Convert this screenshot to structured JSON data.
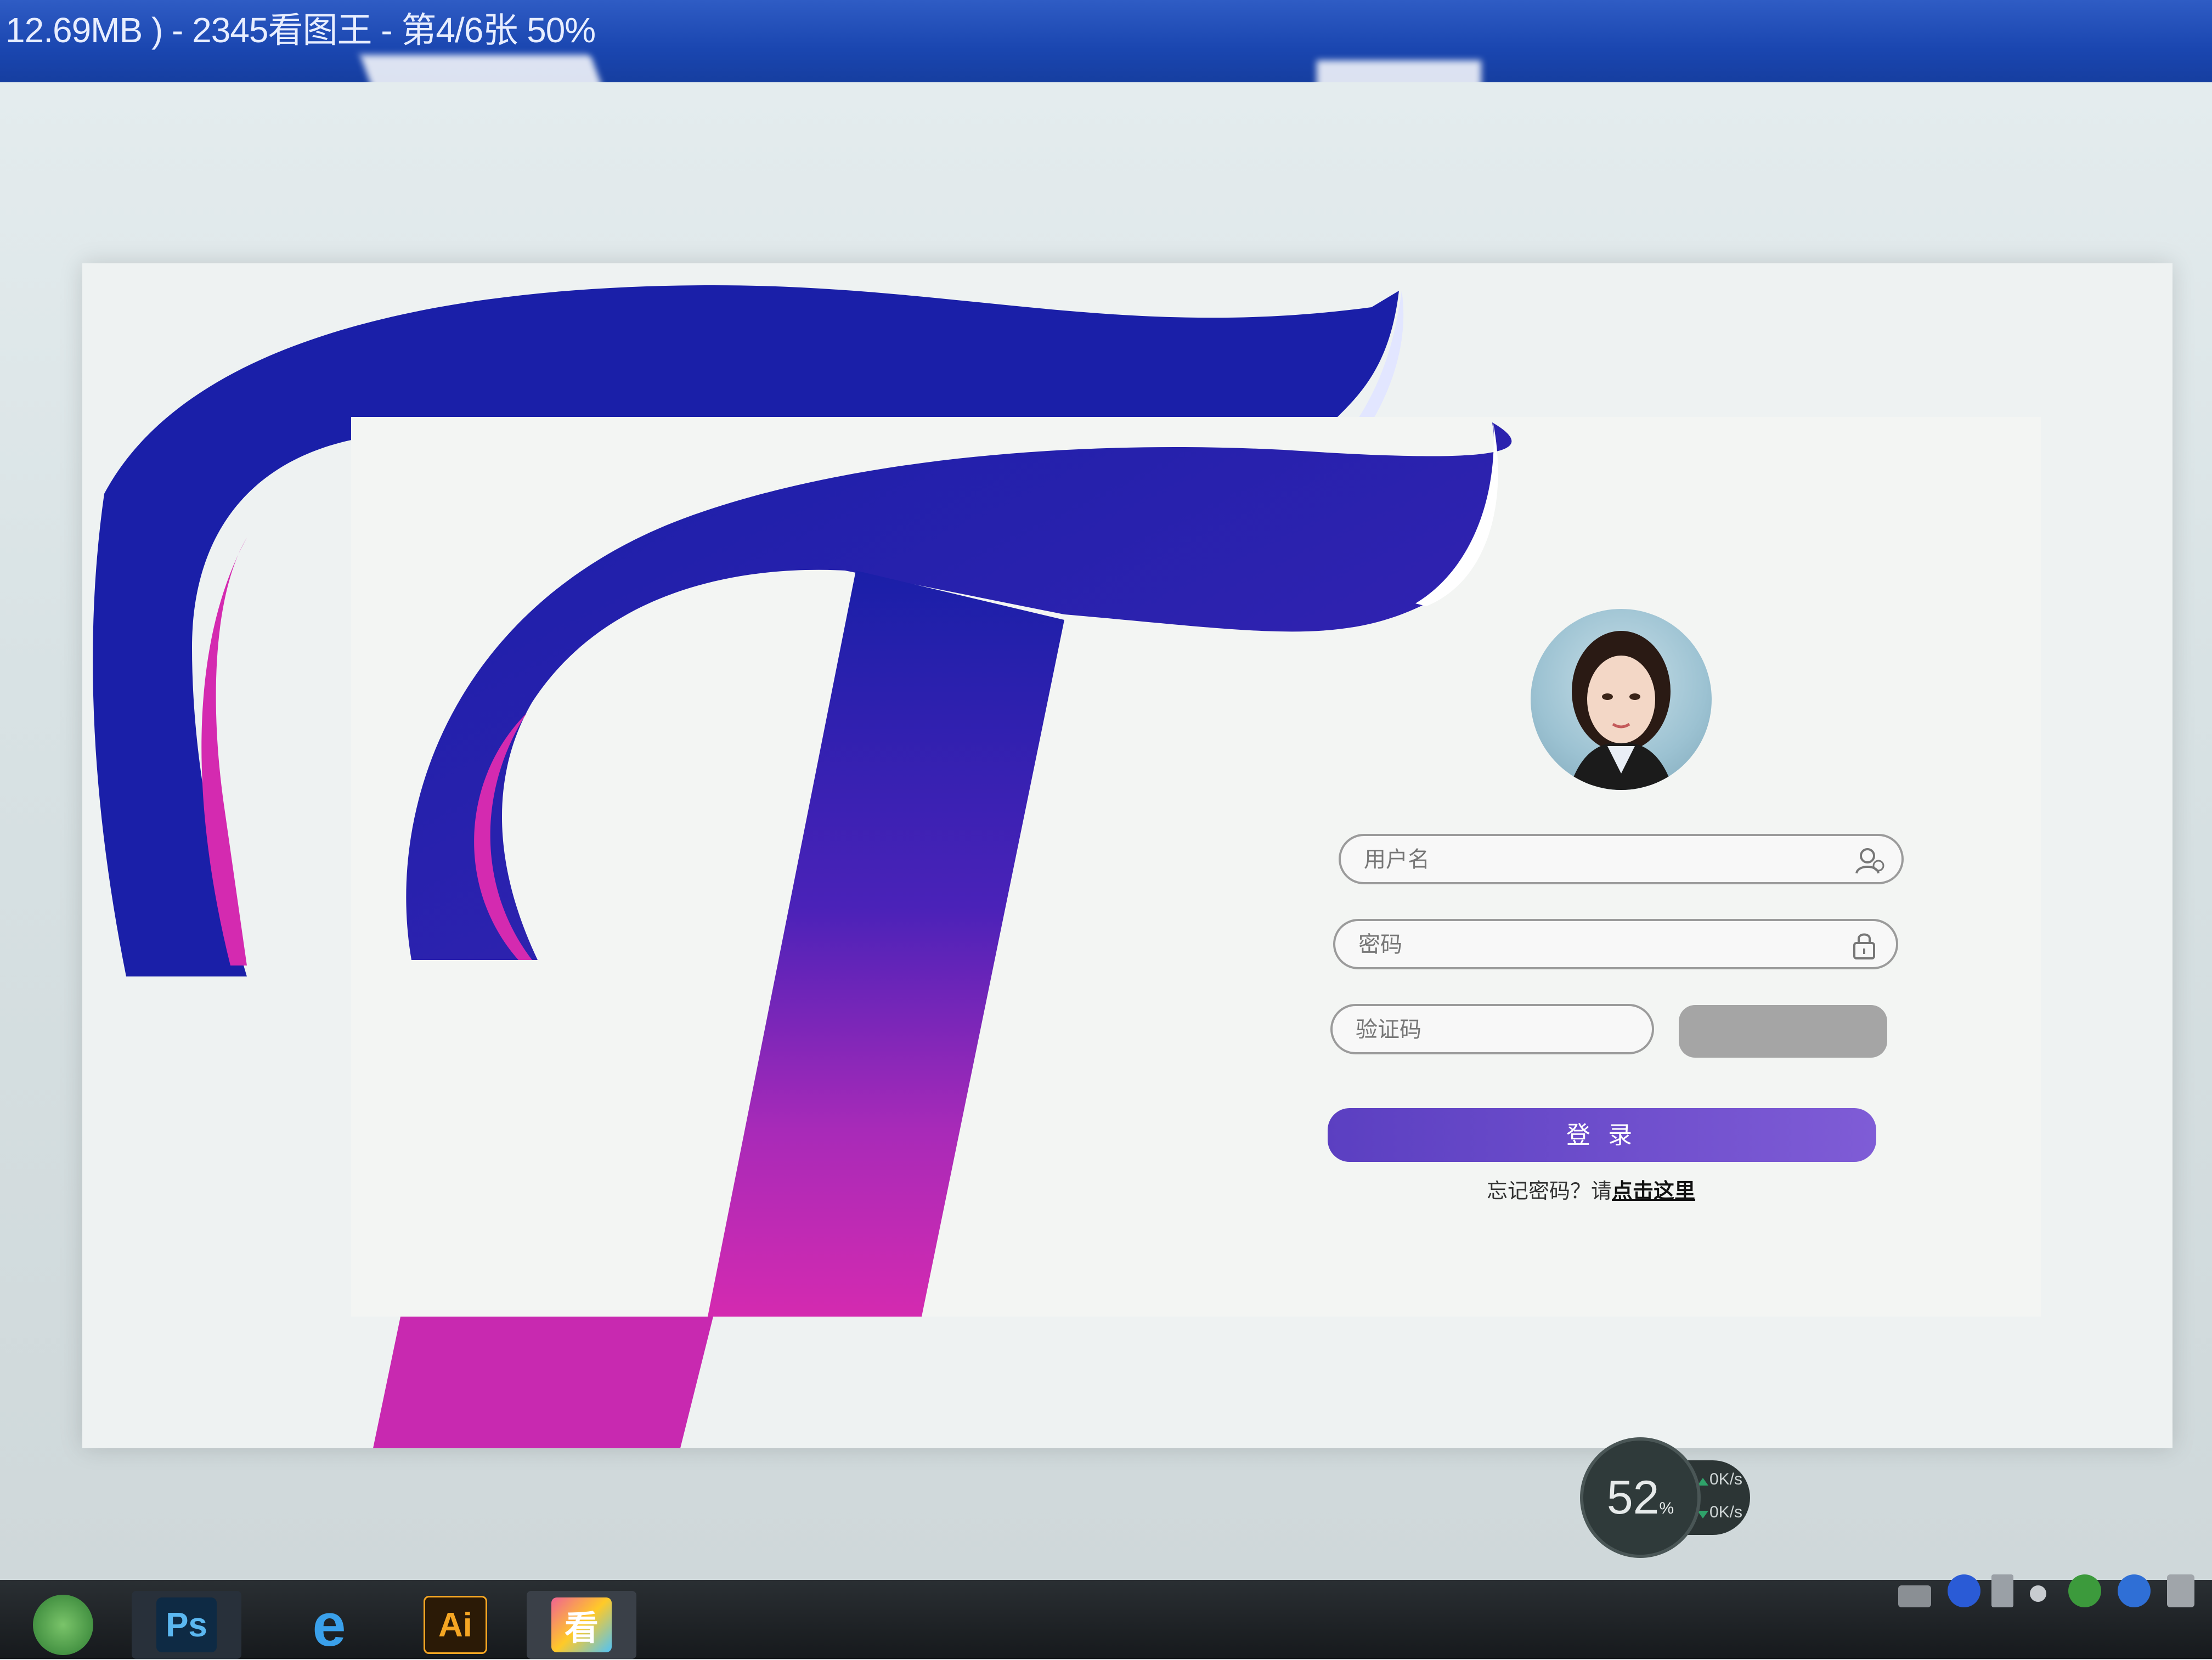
{
  "window": {
    "title": "12.69MB ) - 2345看图王 - 第4/6张 50%"
  },
  "login": {
    "username_placeholder": "用户名",
    "password_placeholder": "密码",
    "captcha_placeholder": "验证码",
    "login_label": "登 录",
    "forgot_prefix": "忘记密码？请",
    "forgot_link": "点击这里"
  },
  "netmon": {
    "percent": "52",
    "percent_unit": "%",
    "upload": "0K/s",
    "download": "0K/s"
  },
  "taskbar": {
    "apps": [
      {
        "name": "start-orb",
        "label": ""
      },
      {
        "name": "photoshop",
        "label": "Ps"
      },
      {
        "name": "internet-explorer",
        "label": "e"
      },
      {
        "name": "illustrator",
        "label": "Ai"
      },
      {
        "name": "image-viewer",
        "label": "看"
      }
    ]
  },
  "colors": {
    "titlebar": "#1a46b0",
    "logo_blue": "#1a1fa8",
    "logo_magenta": "#d42ab0",
    "login_button": "#6a4ccc"
  }
}
